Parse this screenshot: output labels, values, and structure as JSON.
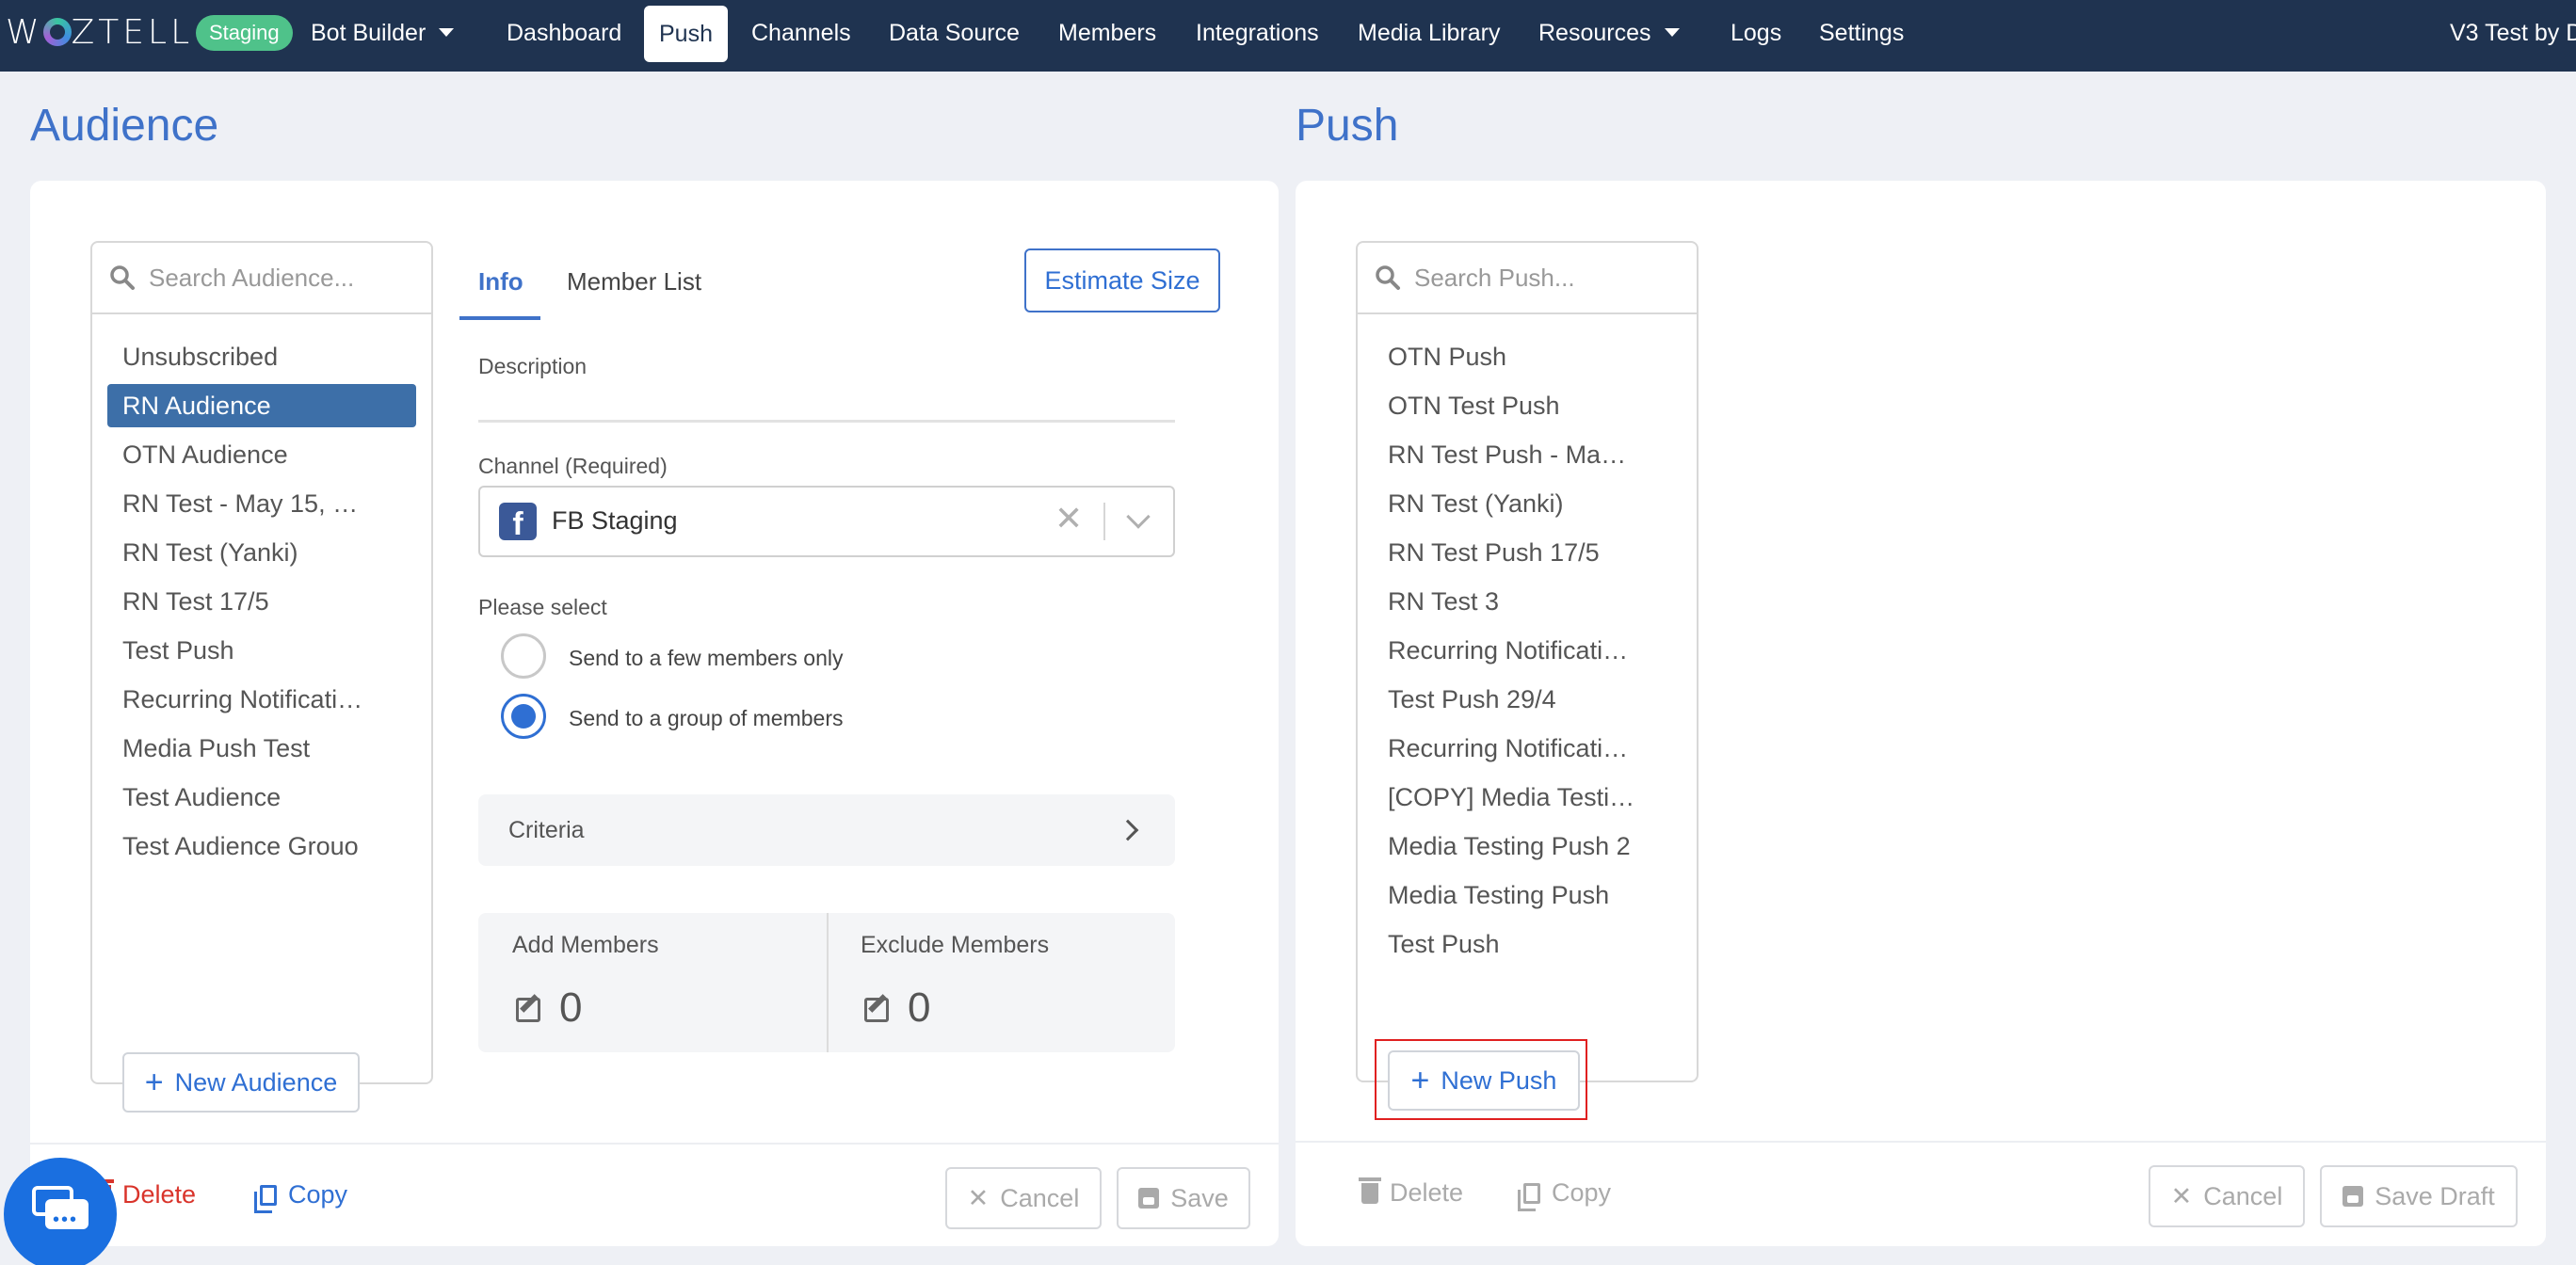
{
  "nav": {
    "logo": "WOZTELL",
    "env_badge": "Staging",
    "items": [
      "Bot Builder",
      "Dashboard",
      "Push",
      "Channels",
      "Data Source",
      "Members",
      "Integrations",
      "Media Library",
      "Resources",
      "Logs",
      "Settings"
    ],
    "active": "Push",
    "user": "V3 Test by D"
  },
  "audience": {
    "title": "Audience",
    "search_placeholder": "Search Audience...",
    "items": [
      "Unsubscribed",
      "RN Audience",
      "OTN Audience",
      "RN Test - May 15, …",
      "RN Test (Yanki)",
      "RN Test 17/5",
      "Test Push",
      "Recurring Notificati…",
      "Media Push Test",
      "Test Audience",
      "Test Audience Grouo"
    ],
    "selected": "RN Audience",
    "new_button": "New Audience",
    "tabs": [
      "Info",
      "Member List"
    ],
    "active_tab": "Info",
    "estimate_button": "Estimate Size",
    "description_label": "Description",
    "channel_label": "Channel (Required)",
    "channel_value": "FB Staging",
    "please_select_label": "Please select",
    "radio_options": [
      "Send to a few members only",
      "Send to a group of members"
    ],
    "radio_selected": "Send to a group of members",
    "criteria_label": "Criteria",
    "add_members_label": "Add Members",
    "add_members_count": "0",
    "exclude_members_label": "Exclude Members",
    "exclude_members_count": "0",
    "footer": {
      "delete": "Delete",
      "copy": "Copy",
      "cancel": "Cancel",
      "save": "Save"
    }
  },
  "push": {
    "title": "Push",
    "search_placeholder": "Search Push...",
    "items": [
      "OTN Push",
      "OTN Test Push",
      "RN Test Push - Ma…",
      "RN Test (Yanki)",
      "RN Test Push 17/5",
      "RN Test 3",
      "Recurring Notificati…",
      "Test Push 29/4",
      "Recurring Notificati…",
      "[COPY] Media Testi…",
      "Media Testing Push 2",
      "Media Testing Push",
      "Test Push"
    ],
    "new_button": "New Push",
    "footer": {
      "delete": "Delete",
      "copy": "Copy",
      "cancel": "Cancel",
      "save_draft": "Save Draft"
    }
  },
  "colors": {
    "nav_bg": "#1f3350",
    "accent": "#3f72c9",
    "selected_bg": "#3d6fa8",
    "staging": "#4fc28a",
    "danger": "#d9342b",
    "chat": "#1a6fe0"
  }
}
